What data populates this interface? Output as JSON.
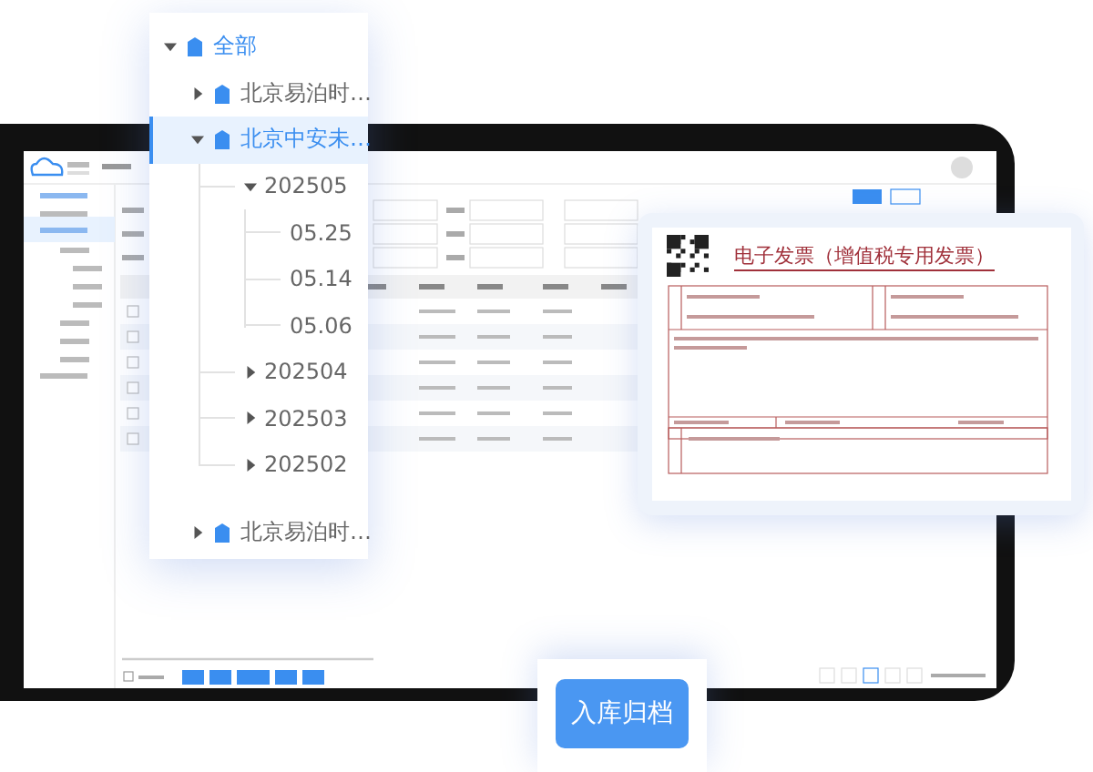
{
  "tree": [
    {
      "label": "全部",
      "kind": "root",
      "selected": false,
      "expanded": true,
      "children": [
        {
          "label": "北京易泊时…",
          "kind": "company",
          "selected": false,
          "expanded": false
        },
        {
          "label": "北京中安未…",
          "kind": "company",
          "selected": true,
          "expanded": true,
          "children": [
            {
              "label": "202505",
              "selected": false,
              "expanded": true,
              "children": [
                {
                  "label": "05.25",
                  "selected": false
                },
                {
                  "label": "05.14",
                  "selected": false
                },
                {
                  "label": "05.06",
                  "selected": false
                }
              ]
            },
            {
              "label": "202504",
              "selected": false,
              "expanded": false
            },
            {
              "label": "202503",
              "selected": false,
              "expanded": false
            },
            {
              "label": "202502",
              "selected": false,
              "expanded": false
            }
          ]
        },
        {
          "label": "北京易泊时…",
          "kind": "company",
          "selected": false,
          "expanded": false
        }
      ]
    }
  ],
  "invoice": {
    "title": "电子发票（增值税专用发票）"
  },
  "action_button": {
    "label": "入库归档"
  }
}
